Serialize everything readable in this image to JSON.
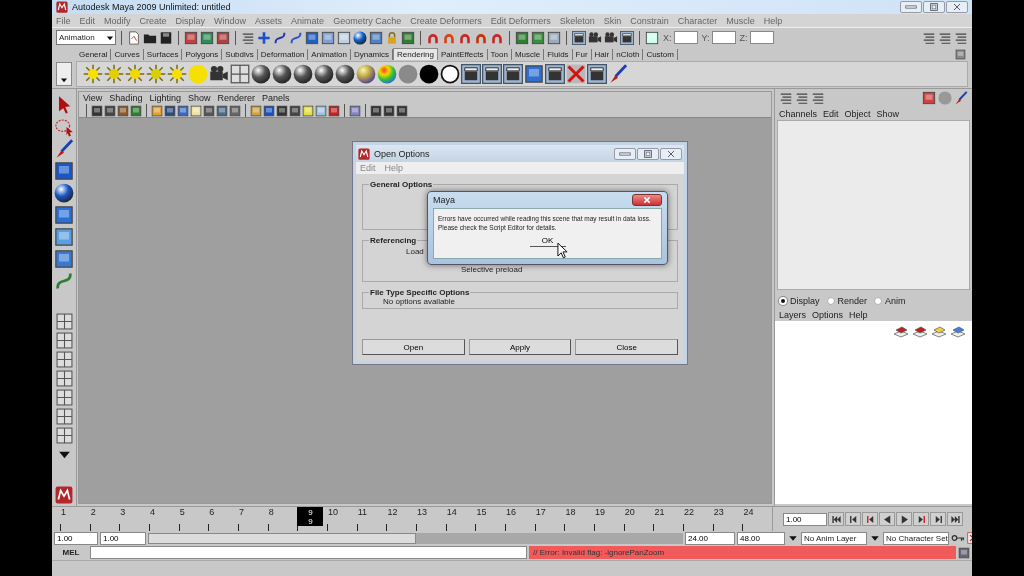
{
  "window": {
    "title": "Autodesk Maya 2009 Unlimited: untitled"
  },
  "menu_bar": [
    "File",
    "Edit",
    "Modify",
    "Create",
    "Display",
    "Window",
    "Assets",
    "Animate",
    "Geometry Cache",
    "Create Deformers",
    "Edit Deformers",
    "Skeleton",
    "Skin",
    "Constrain",
    "Character",
    "Muscle",
    "Help"
  ],
  "status_line": {
    "mode": "Animation",
    "fields": [
      {
        "label": "X:"
      },
      {
        "label": "Y:"
      },
      {
        "label": "Z:"
      }
    ]
  },
  "shelf_tabs": [
    {
      "label": "General",
      "selected": false
    },
    {
      "label": "Curves",
      "selected": false
    },
    {
      "label": "Surfaces",
      "selected": false
    },
    {
      "label": "Polygons",
      "selected": false
    },
    {
      "label": "Subdivs",
      "selected": false
    },
    {
      "label": "Deformation",
      "selected": false
    },
    {
      "label": "Animation",
      "selected": false
    },
    {
      "label": "Dynamics",
      "selected": false
    },
    {
      "label": "Rendering",
      "selected": true
    },
    {
      "label": "PaintEffects",
      "selected": false
    },
    {
      "label": "Toon",
      "selected": false
    },
    {
      "label": "Muscle",
      "selected": false
    },
    {
      "label": "Fluids",
      "selected": false
    },
    {
      "label": "Fur",
      "selected": false
    },
    {
      "label": "Hair",
      "selected": false
    },
    {
      "label": "nCloth",
      "selected": false
    },
    {
      "label": "Custom",
      "selected": false
    }
  ],
  "panel_menu": [
    "View",
    "Shading",
    "Lighting",
    "Show",
    "Renderer",
    "Panels"
  ],
  "channel_box": {
    "menu": [
      "Channels",
      "Edit",
      "Object",
      "Show"
    ]
  },
  "layer_editor": {
    "modes": [
      {
        "label": "Display",
        "selected": true
      },
      {
        "label": "Render",
        "selected": false
      },
      {
        "label": "Anim",
        "selected": false
      }
    ],
    "menu": [
      "Layers",
      "Options",
      "Help"
    ]
  },
  "time_slider": {
    "frames": [
      {
        "label": "1",
        "selected": false
      },
      {
        "label": "2",
        "selected": false
      },
      {
        "label": "3",
        "selected": false
      },
      {
        "label": "4",
        "selected": false
      },
      {
        "label": "5",
        "selected": false
      },
      {
        "label": "6",
        "selected": false
      },
      {
        "label": "7",
        "selected": false
      },
      {
        "label": "8",
        "selected": false
      },
      {
        "label": "9",
        "selected": true
      },
      {
        "label": "10",
        "selected": false
      },
      {
        "label": "11",
        "selected": false
      },
      {
        "label": "12",
        "selected": false
      },
      {
        "label": "13",
        "selected": false
      },
      {
        "label": "14",
        "selected": false
      },
      {
        "label": "15",
        "selected": false
      },
      {
        "label": "16",
        "selected": false
      },
      {
        "label": "17",
        "selected": false
      },
      {
        "label": "18",
        "selected": false
      },
      {
        "label": "19",
        "selected": false
      },
      {
        "label": "20",
        "selected": false
      },
      {
        "label": "21",
        "selected": false
      },
      {
        "label": "22",
        "selected": false
      },
      {
        "label": "23",
        "selected": false
      },
      {
        "label": "24",
        "selected": false
      }
    ],
    "current_sublabel": "9",
    "current_time": "1.00"
  },
  "range_slider": {
    "start": "1.00",
    "range_start": "1.00",
    "level": 0.5,
    "range_end": "24.00",
    "end": "48.00",
    "anim_layer": "No Anim Layer",
    "character_set": "No Character Set"
  },
  "command_line": {
    "language": "MEL",
    "result": "// Error: Invalid flag: -ignorePanZoom"
  },
  "open_options": {
    "title": "Open Options",
    "menu": [
      "Edit",
      "Help"
    ],
    "groups": [
      {
        "title": "General Options"
      },
      {
        "title": "Referencing",
        "label": "Load",
        "option": "Selective preload"
      },
      {
        "title": "File Type Specific Options",
        "note": "No options available"
      }
    ],
    "buttons": [
      "Open",
      "Apply",
      "Close"
    ]
  },
  "alert": {
    "title": "Maya",
    "message": [
      "Errors have occurred while reading this scene that may result in data loss.",
      "Please check the Script Editor for details."
    ],
    "button": "OK"
  }
}
